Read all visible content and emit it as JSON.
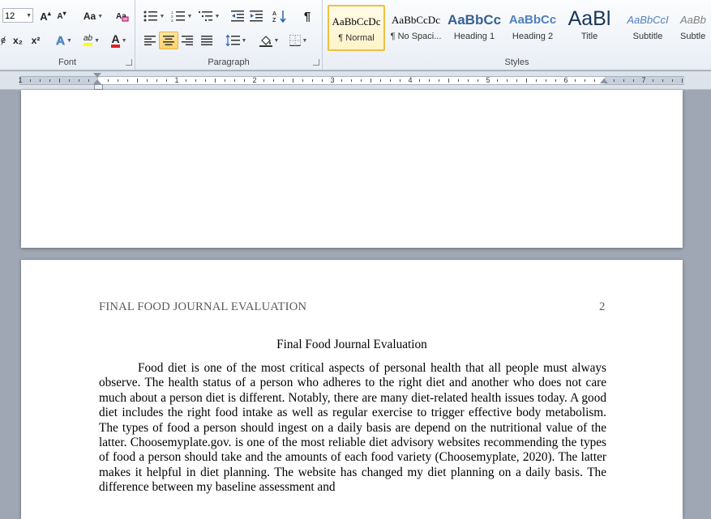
{
  "ribbon": {
    "font": {
      "label": "Font",
      "size_value": "12",
      "grow_label": "A",
      "shrink_label": "A",
      "change_case_label": "Aa",
      "subscript_label": "x₂",
      "superscript_label": "x²",
      "font_color_label": "A",
      "highlight_label": "ab"
    },
    "paragraph": {
      "label": "Paragraph",
      "show_marks_label": "¶"
    },
    "styles": {
      "label": "Styles",
      "items": [
        {
          "sample": "AaBbCcDc",
          "name": "¶ Normal"
        },
        {
          "sample": "AaBbCcDc",
          "name": "¶ No Spaci..."
        },
        {
          "sample": "AaBbCc",
          "name": "Heading 1"
        },
        {
          "sample": "AaBbCc",
          "name": "Heading 2"
        },
        {
          "sample": "AaBl",
          "name": "Title"
        },
        {
          "sample": "AaBbCcI",
          "name": "Subtitle"
        },
        {
          "sample": "AaBb",
          "name": "Subtle"
        }
      ]
    }
  },
  "ruler": {
    "numbers": [
      "1",
      "1",
      "2",
      "3",
      "4",
      "5",
      "6",
      "7"
    ]
  },
  "document": {
    "header": "FINAL FOOD JOURNAL EVALUATION",
    "page_number": "2",
    "title": "Final Food Journal Evaluation",
    "paragraph": "Food diet is one of the most critical aspects of personal health that all people must always observe. The health status of a person who adheres to the right diet and another who does not care much about a person diet is different. Notably, there are many diet-related health issues today. A good diet includes the right food intake as well as regular exercise to trigger effective body metabolism. The types of food a person should ingest on a daily basis are depend on the nutritional value of the latter. Choosemyplate.gov. is one of the most reliable diet advisory websites recommending the types of food a person should take and the amounts of each food variety (Choosemyplate, 2020). The latter makes it helpful in diet planning. The website has changed my diet planning on a daily basis. The difference between my baseline assessment and"
  },
  "colors": {
    "accent_highlight": "#ffd16a",
    "heading_blue": "#365f91",
    "font_color_red": "#e02020",
    "highlight_yellow": "#ffff00"
  }
}
